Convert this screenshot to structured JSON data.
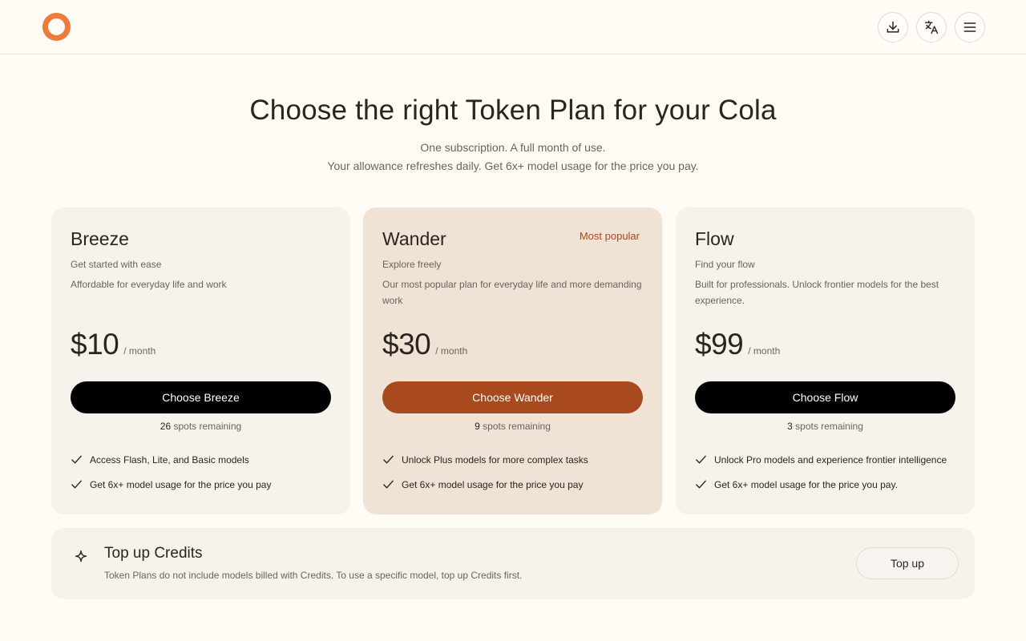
{
  "header": {
    "logo": "logo-ring",
    "actions": [
      {
        "icon": "download-icon"
      },
      {
        "icon": "translate-icon"
      },
      {
        "icon": "menu-icon"
      }
    ]
  },
  "hero": {
    "title": "Choose the right Token Plan for your Cola",
    "subtitle_line1": "One subscription. A full month of use.",
    "subtitle_line2": "Your allowance refreshes daily. Get 6x+ model usage for the price you pay."
  },
  "plans": [
    {
      "name": "Breeze",
      "badge": "",
      "tagline": "Get started with ease",
      "description": "Affordable for everyday life and work",
      "price": "$10",
      "period": "/ month",
      "button": "Choose Breeze",
      "spots_count": "26",
      "spots_text": "spots remaining",
      "features": [
        "Access Flash, Lite, and Basic models",
        "Get 6x+ model usage for the price you pay"
      ]
    },
    {
      "name": "Wander",
      "badge": "Most popular",
      "tagline": "Explore freely",
      "description": "Our most popular plan for everyday life and more demanding work",
      "price": "$30",
      "period": "/ month",
      "button": "Choose Wander",
      "spots_count": "9",
      "spots_text": "spots remaining",
      "features": [
        "Unlock Plus models for more complex tasks",
        "Get 6x+ model usage for the price you pay"
      ]
    },
    {
      "name": "Flow",
      "badge": "",
      "tagline": "Find your flow",
      "description": "Built for professionals. Unlock frontier models for the best experience.",
      "price": "$99",
      "period": "/ month",
      "button": "Choose Flow",
      "spots_count": "3",
      "spots_text": "spots remaining",
      "features": [
        "Unlock Pro models and experience frontier intelligence",
        "Get 6x+ model usage for the price you pay."
      ]
    }
  ],
  "topup": {
    "icon": "sparkle-icon",
    "title": "Top up Credits",
    "description": "Token Plans do not include models billed with Credits. To use a specific model, top up Credits first.",
    "button": "Top up"
  },
  "colors": {
    "accent": "#a84a1e",
    "logo": "#f07a3a",
    "background": "#fffcf6",
    "card": "#f6f2ec",
    "featured_card": "#f0e2d5"
  }
}
